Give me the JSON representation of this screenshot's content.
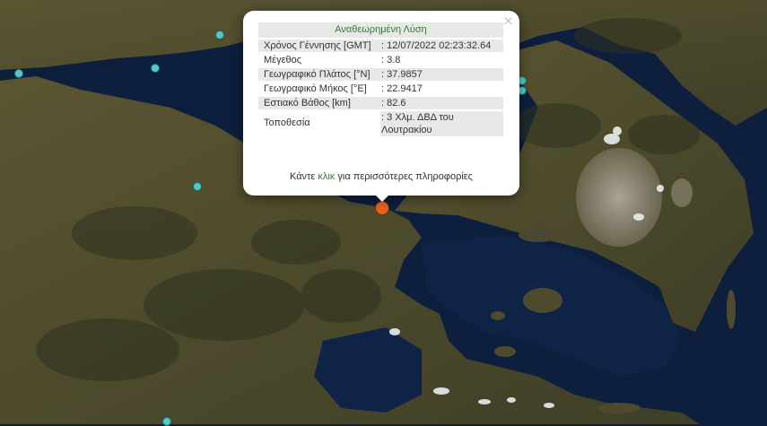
{
  "popup": {
    "title": "Αναθεωρημένη Λύση",
    "close": "×",
    "rows": [
      {
        "label": "Χρόνος Γέννησης [GMT]",
        "value": ": 12/07/2022 02:23:32.64"
      },
      {
        "label": "Μέγεθος",
        "value": ": 3.8"
      },
      {
        "label": "Γεωγραφικό Πλάτος [°N]",
        "value": ": 37.9857"
      },
      {
        "label": "Γεωγραφικό Μήκος [°E]",
        "value": ": 22.9417"
      },
      {
        "label": "Εστιακό Βάθος [km]",
        "value": ": 82.6"
      },
      {
        "label": "Τοποθεσία",
        "value": ": 3 Χλμ. ΔΒΔ του Λουτρακίου"
      }
    ],
    "more_prefix": "Κάντε ",
    "more_link": "κλικ",
    "more_suffix": " για περισσότερες πληροφορίες"
  },
  "colors": {
    "sea": "#0d1f3d",
    "land": "#4e4a2e",
    "station": "#4fc9c9",
    "epicenter": "#e2621f",
    "link": "#2f7d2f"
  }
}
